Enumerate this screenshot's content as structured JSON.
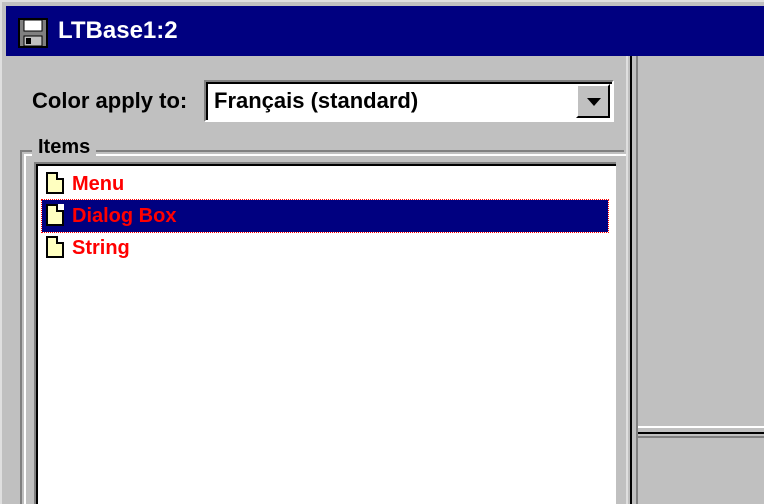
{
  "window": {
    "title": "LTBase1:2",
    "icon": "floppy-disk-icon"
  },
  "color_apply": {
    "label": "Color apply to:",
    "value": "Français (standard)"
  },
  "items_group": {
    "label": "Items"
  },
  "items": [
    {
      "label": "Menu",
      "icon": "document-icon",
      "selected": false
    },
    {
      "label": "Dialog Box",
      "icon": "document-icon",
      "selected": true
    },
    {
      "label": "String",
      "icon": "document-icon",
      "selected": false
    }
  ],
  "colors": {
    "titlebar": "#000080",
    "item_text": "#ff0000",
    "selection": "#000080",
    "face": "#c0c0c0"
  }
}
